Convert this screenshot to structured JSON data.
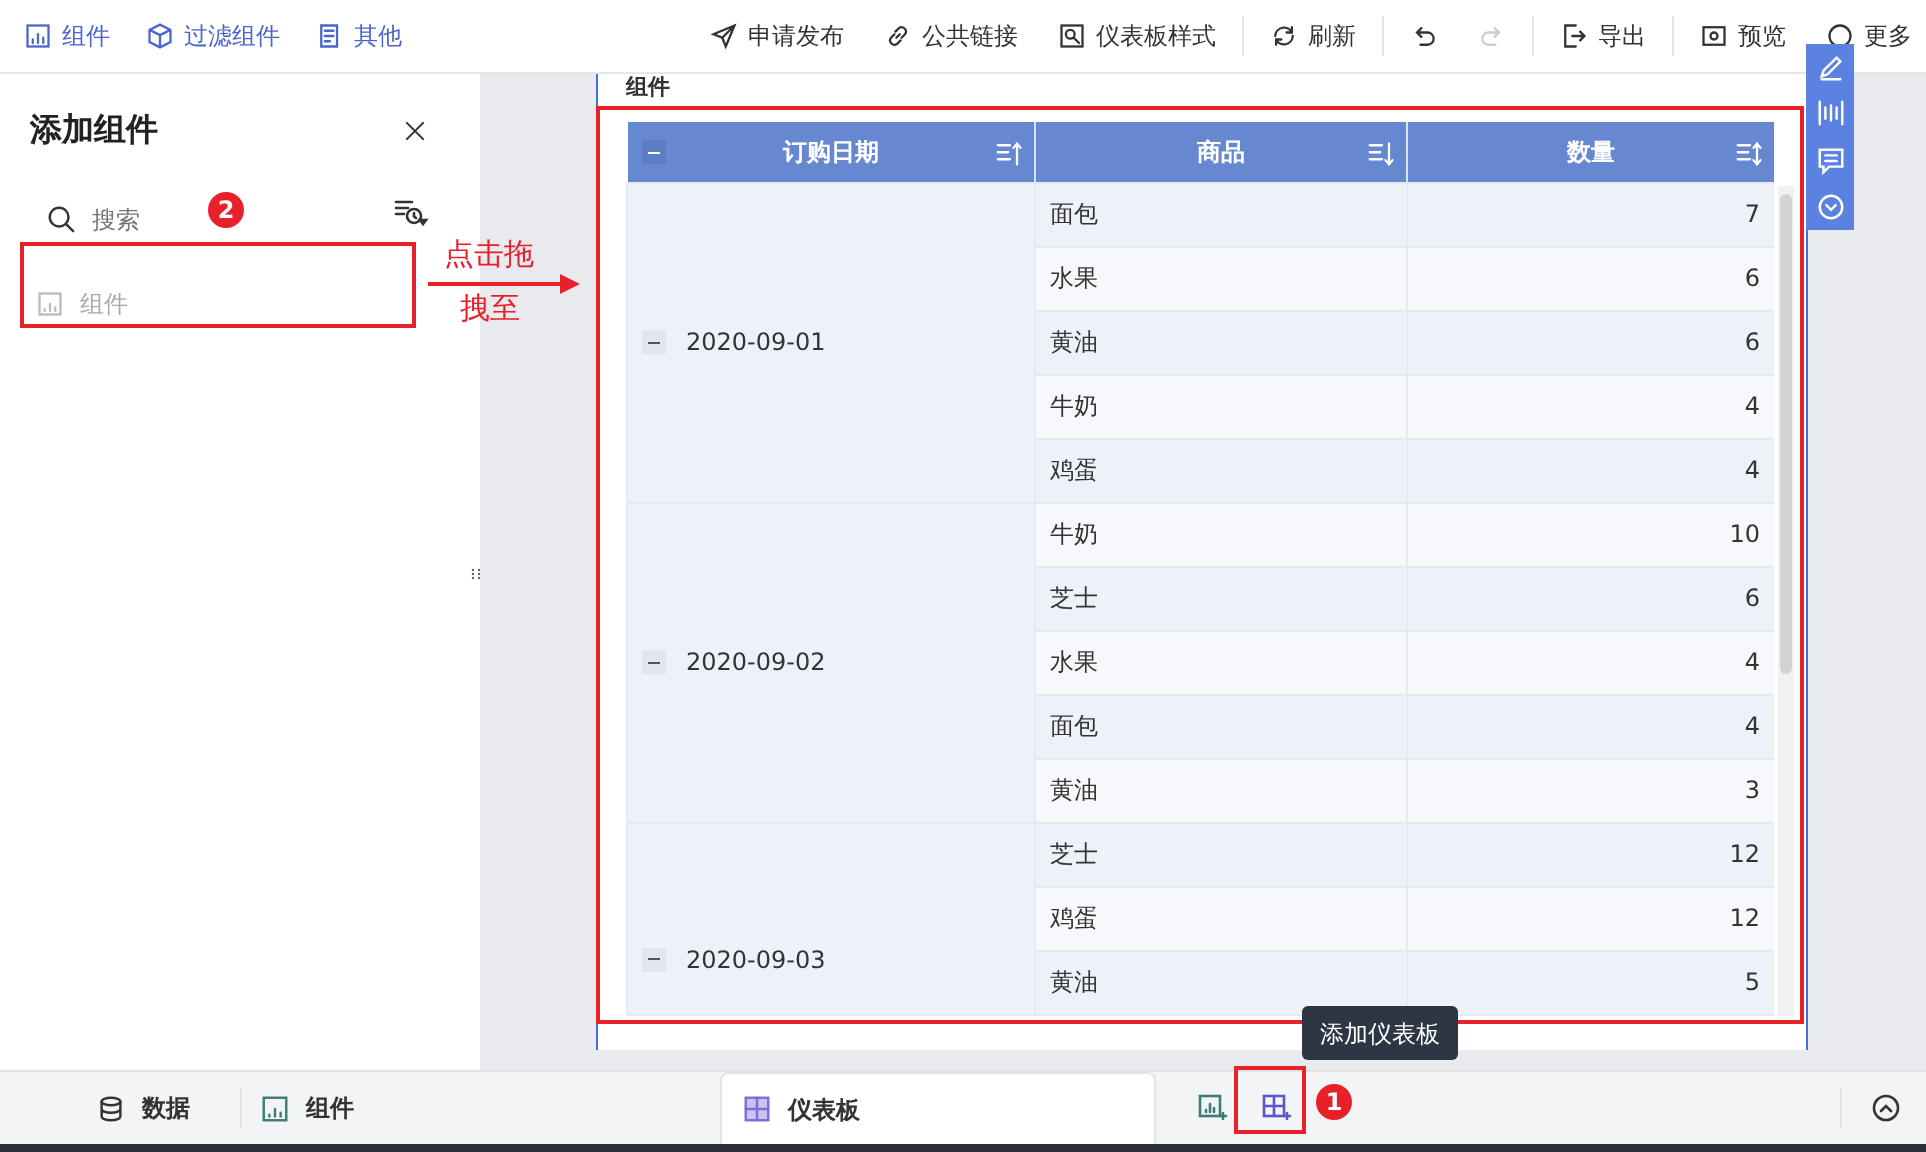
{
  "toolbar_left": [
    {
      "kind": "widget",
      "label": "组件"
    },
    {
      "kind": "filter",
      "label": "过滤组件"
    },
    {
      "kind": "other",
      "label": "其他"
    }
  ],
  "toolbar_right": [
    {
      "kind": "send",
      "label": "申请发布",
      "disabled": false
    },
    {
      "kind": "link",
      "label": "公共链接",
      "disabled": false
    },
    {
      "kind": "style",
      "label": "仪表板样式",
      "disabled": false
    },
    {
      "kind": "refresh",
      "label": "刷新",
      "disabled": false
    },
    {
      "kind": "undo",
      "disabled": false
    },
    {
      "kind": "redo",
      "disabled": true
    },
    {
      "kind": "export",
      "label": "导出",
      "disabled": false
    },
    {
      "kind": "preview",
      "label": "预览",
      "disabled": false
    },
    {
      "kind": "more",
      "label": "更多",
      "disabled": false
    }
  ],
  "panel": {
    "title": "添加组件",
    "search": {
      "placeholder": "搜索"
    },
    "items": [
      {
        "label": "组件"
      }
    ]
  },
  "annotations": {
    "search_badge": "2",
    "drag_hint": [
      "点击拖",
      "拽至"
    ],
    "add_badge": "1",
    "tooltip": "添加仪表板"
  },
  "widget": {
    "title": "组件",
    "columns": [
      {
        "label": "订购日期",
        "kind": "asc",
        "collapsible": true
      },
      {
        "label": "商品",
        "kind": "desc",
        "collapsible": false
      },
      {
        "label": "数量",
        "kind": "both",
        "collapsible": false
      }
    ],
    "groups": [
      {
        "date": "2020-09-01",
        "expanded": true,
        "rows": [
          [
            "面包",
            "7"
          ],
          [
            "水果",
            "6"
          ],
          [
            "黄油",
            "6"
          ],
          [
            "牛奶",
            "4"
          ],
          [
            "鸡蛋",
            "4"
          ]
        ]
      },
      {
        "date": "2020-09-02",
        "expanded": true,
        "rows": [
          [
            "牛奶",
            "10"
          ],
          [
            "芝士",
            "6"
          ],
          [
            "水果",
            "4"
          ],
          [
            "面包",
            "4"
          ],
          [
            "黄油",
            "3"
          ]
        ]
      },
      {
        "date": "2020-09-03",
        "expanded": true,
        "rows": [
          [
            "芝士",
            "12"
          ],
          [
            "鸡蛋",
            "12"
          ],
          [
            "黄油",
            "5"
          ]
        ]
      }
    ]
  },
  "bottom_bar": {
    "tabs": [
      {
        "kind": "data",
        "label": "数据",
        "selected": false
      },
      {
        "kind": "chart",
        "label": "组件",
        "selected": false
      },
      {
        "kind": "dashboard",
        "label": "仪表板",
        "selected": true
      }
    ]
  }
}
